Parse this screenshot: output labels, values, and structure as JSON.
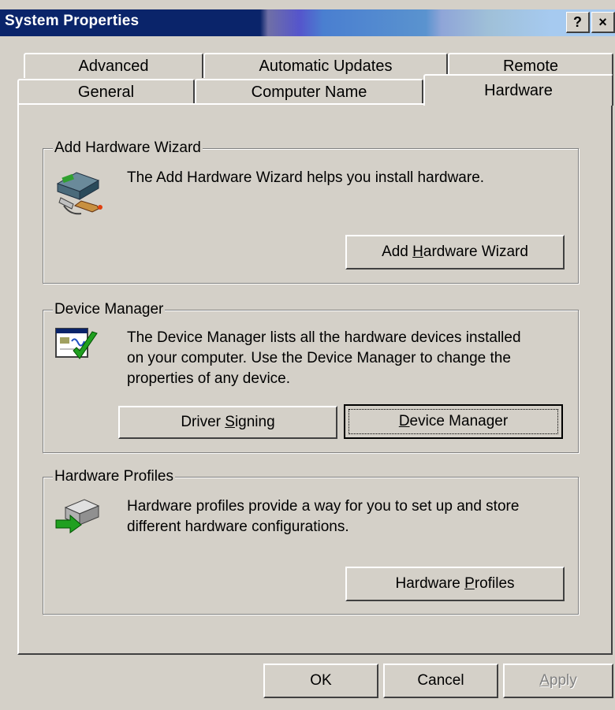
{
  "window": {
    "title": "System Properties",
    "help_button": "?",
    "close_button": "×"
  },
  "tabs": {
    "row1": [
      "Advanced",
      "Automatic Updates",
      "Remote"
    ],
    "row2": [
      "General",
      "Computer Name",
      "Hardware"
    ],
    "selected": "Hardware"
  },
  "add_hardware": {
    "legend": "Add Hardware Wizard",
    "description": "The Add Hardware Wizard helps you install hardware.",
    "button_pre": "Add ",
    "button_u": "H",
    "button_post": "ardware Wizard"
  },
  "device_manager": {
    "legend": "Device Manager",
    "description_line1": "The Device Manager lists all the hardware devices installed",
    "description_line2": "on your computer. Use the Device Manager to change the",
    "description_line3": "properties of any device.",
    "driver_btn_pre": "Driver ",
    "driver_btn_u": "S",
    "driver_btn_post": "igning",
    "devmgr_btn_u": "D",
    "devmgr_btn_post": "evice Manager"
  },
  "hardware_profiles": {
    "legend": "Hardware Profiles",
    "description_line1": "Hardware profiles provide a way for you to set up and store",
    "description_line2": "different hardware configurations.",
    "button_pre": "Hardware ",
    "button_u": "P",
    "button_post": "rofiles"
  },
  "footer": {
    "ok": "OK",
    "cancel": "Cancel",
    "apply_u": "A",
    "apply_post": "pply"
  }
}
